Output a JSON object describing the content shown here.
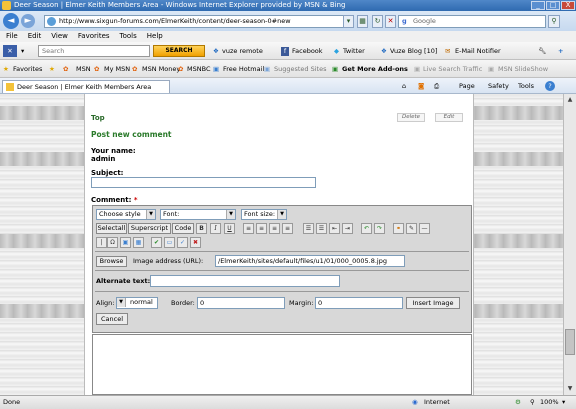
{
  "window": {
    "title": "Deer Season | Elmer Keith Members Area - Windows Internet Explorer provided by MSN & Bing",
    "minimize": "_",
    "maximize": "□",
    "close": "X"
  },
  "nav": {
    "back": "◄",
    "forward": "►",
    "url": "http://www.sixgun-forums.com/ElmerKeith/content/deer-season-0#new",
    "search_placeholder": "Google"
  },
  "menu": [
    "File",
    "Edit",
    "View",
    "Favorites",
    "Tools",
    "Help"
  ],
  "toolbar": {
    "search_placeholder": "Search",
    "search_button": "SEARCH",
    "items": [
      "vuze remote",
      "Facebook",
      "Twitter",
      "Vuze Blog [10]",
      "E-Mail Notifier"
    ]
  },
  "favorites": {
    "label": "Favorites",
    "items": [
      "MSN",
      "My MSN",
      "MSN Money",
      "MSNBC",
      "Free Hotmail",
      "Suggested Sites",
      "Get More Add-ons",
      "Live Search Traffic",
      "MSN SlideShow"
    ]
  },
  "tab": {
    "title": "Deer Season | Elmer Keith Members Area",
    "page": "Page",
    "safety": "Safety",
    "tools": "Tools",
    "help": "?"
  },
  "post": {
    "top_link": "Top",
    "delete_link": "Delete",
    "edit_link": "Edit",
    "heading": "Post new comment",
    "name_label": "Your name:",
    "name_value": "admin",
    "subject_label": "Subject:",
    "comment_label": "Comment:",
    "required_mark": "*"
  },
  "editor": {
    "style_select": "Choose style",
    "font_select": "Font:",
    "size_select": "Font size:",
    "selectall": "Selectall",
    "superscript": "Superscript",
    "code": "Code",
    "bold": "B",
    "italic": "I",
    "underline": "U",
    "browse": "Browse",
    "image_address_label": "Image address (URL):",
    "image_address_value": "/ElmerKeith/sites/default/files/u1/01/000_0005.8.jpg",
    "alt_text_label": "Alternate text:",
    "align_label": "Align:",
    "align_value": "normal",
    "border_label": "Border:",
    "border_value": "0",
    "margin_label": "Margin:",
    "margin_value": "0",
    "insert_image": "Insert Image",
    "cancel": "Cancel"
  },
  "status": {
    "text": "Done",
    "zone": "Internet",
    "zoom": "100%"
  },
  "colors": {
    "title_bar": "#2f6ab0",
    "post_heading": "#2a7a2a",
    "required": "#cc0000"
  }
}
